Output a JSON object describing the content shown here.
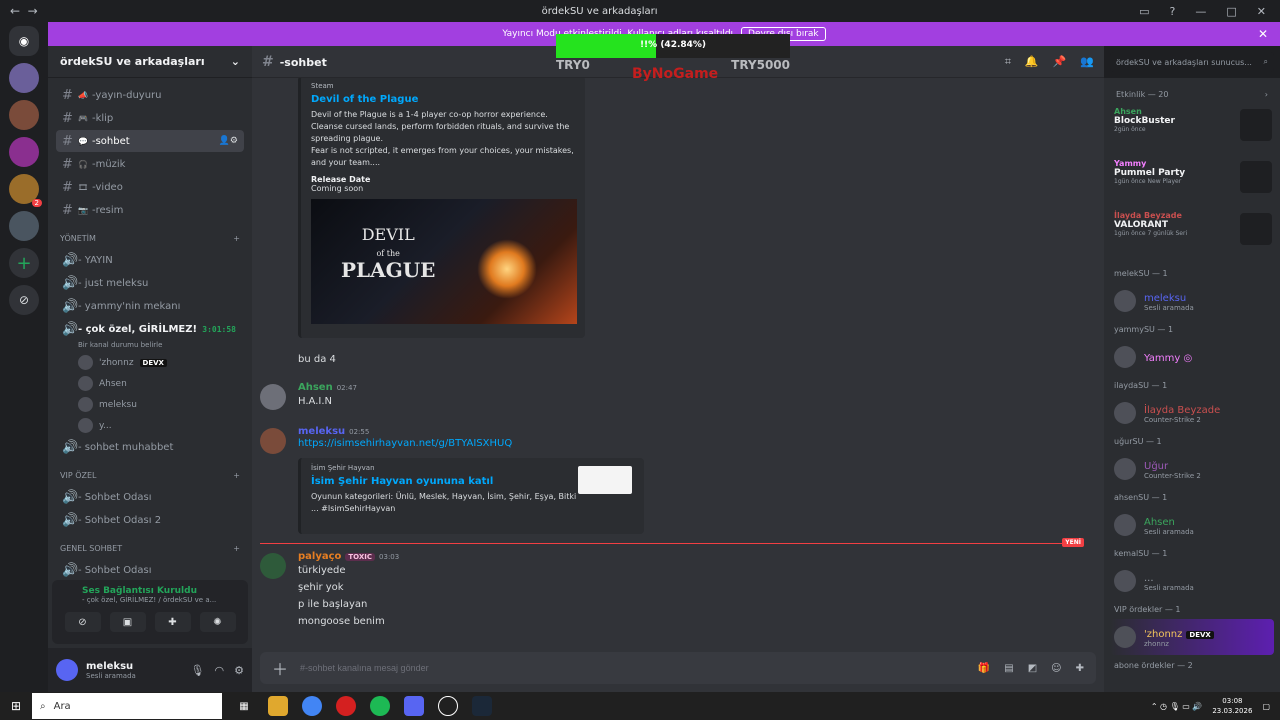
{
  "window": {
    "title": "ördekSU ve arkadaşları"
  },
  "stream_bar": {
    "text": "Yayıncı Modu etkinleştirildi. Kullanıcı adları kısaltıldı",
    "button": "Devre dışı bırak"
  },
  "overlay": {
    "progress_text": "!!% (42.84%)",
    "progress_fraction": 0.4284,
    "left_label": "TRY0",
    "right_label": "TRY5000",
    "brand": "ByNoGame"
  },
  "server": {
    "name": "ördekSU ve arkadaşları"
  },
  "channels_top": [
    {
      "label": "-yayın-duyuru",
      "icon": "megaphone"
    },
    {
      "label": "-klip",
      "icon": "gamepad"
    },
    {
      "label": "-sohbet",
      "icon": "chat",
      "active": true
    },
    {
      "label": "-müzik",
      "icon": "headphones"
    },
    {
      "label": "-video",
      "icon": "film"
    },
    {
      "label": "-resim",
      "icon": "camera"
    }
  ],
  "categories": {
    "yonetim": "YÖNETİM",
    "vip": "VIP Özel",
    "genel": "Genel Sohbet"
  },
  "voice_channels": [
    {
      "label": "- YAYIN"
    },
    {
      "label": "- just meleksu"
    },
    {
      "label": "- yammy'nin mekanı"
    }
  ],
  "private_channel": {
    "label": "- çok özel, GİRİLMEZ!",
    "time": "3:01:58",
    "status": "Bir kanal durumu belirle"
  },
  "voice_users": [
    {
      "name": "'zhonnz",
      "tag": "DEVX"
    },
    {
      "name": "Ahsen"
    },
    {
      "name": "meleksu"
    },
    {
      "name": "y..."
    }
  ],
  "more_voice": [
    {
      "label": "- sohbet muhabbet"
    }
  ],
  "vip_channels": [
    {
      "label": "- Sohbet Odası"
    },
    {
      "label": "- Sohbet Odası 2"
    }
  ],
  "genel_channels": [
    {
      "label": "- Sohbet Odası"
    }
  ],
  "voice_panel": {
    "status": "Ses Bağlantısı Kuruldu",
    "sub": "- çok özel, GİRİLMEZ! / ördekSU ve a..."
  },
  "user_panel": {
    "name": "meleksu",
    "status": "Sesli aramada"
  },
  "chat_header": {
    "title": "-sohbet"
  },
  "embed1": {
    "provider": "Steam",
    "title": "Devil of the Plague",
    "description": "Devil of the Plague is a 1-4 player co-op horror experience.\n        Cleanse cursed lands, perform forbidden rituals, and survive the spreading plague.\n        Fear is not scripted, it emerges from your choices, your mistakes, and your team....",
    "field_name": "Release Date",
    "field_value": "Coming soon",
    "image_word_top": "DEVIL",
    "image_word_small": "of the",
    "image_word_bottom": "PLAGUE"
  },
  "after_embed": "bu da 4",
  "msg_ahsen": {
    "name": "Ahsen",
    "time": "02:47",
    "text": "H.A.I.N"
  },
  "msg_meleksu": {
    "name": "meleksu",
    "time": "02:55",
    "link": "https://isimsehirhayvan.net/g/BTYAISXHUQ"
  },
  "embed2": {
    "provider": "İsim Şehir Hayvan",
    "title": "İsim Şehir Hayvan oyununa katıl",
    "description": "Oyunun kategorileri: Ünlü, Meslek, Hayvan, İsim, Şehir, Eşya, Bitki ... #IsimSehirHayvan"
  },
  "new_label": "YENİ",
  "msg_palyaco": {
    "name": "palyaço",
    "badge": "TOXIC",
    "time": "03:03",
    "lines": [
      "türkiyede",
      "şehir yok",
      "p ile başlayan",
      "mongoose benim"
    ]
  },
  "composer": {
    "placeholder": "#-sohbet kanalına mesaj gönder"
  },
  "search": {
    "placeholder": "ördekSU ve arkadaşları sunucus..."
  },
  "activity_header": "Etkinlik — 20",
  "activities": [
    {
      "user": "Ahsen",
      "game": "BlockBuster",
      "detail": "2gün önce",
      "color": "#3ba55d"
    },
    {
      "user": "Yammy",
      "game": "Pummel Party",
      "detail": "1gün önce   New Player",
      "color": "#f47fff"
    },
    {
      "user": "İlayda Beyzade",
      "game": "VALORANT",
      "detail": "1gün önce   7 günlük Seri",
      "color": "#c94f4f"
    }
  ],
  "member_groups": [
    {
      "title": "melekSU — 1",
      "members": [
        {
          "name": "meleksu",
          "status": "Sesli aramada",
          "color": "#5865f2"
        }
      ]
    },
    {
      "title": "yammySU — 1",
      "members": [
        {
          "name": "Yammy ◎",
          "status": "",
          "color": "#f47fff"
        }
      ]
    },
    {
      "title": "ilaydaSU — 1",
      "members": [
        {
          "name": "İlayda Beyzade",
          "status": "Counter-Strike 2",
          "color": "#c94f4f"
        }
      ]
    },
    {
      "title": "uğurSU — 1",
      "members": [
        {
          "name": "Uğur",
          "status": "Counter-Strike 2",
          "color": "#9b59b6"
        }
      ]
    },
    {
      "title": "ahsenSU — 1",
      "members": [
        {
          "name": "Ahsen",
          "status": "Sesli aramada",
          "color": "#3ba55d"
        }
      ]
    },
    {
      "title": "kemalSU — 1",
      "members": [
        {
          "name": "...",
          "status": "Sesli aramada",
          "color": "#949ba4"
        }
      ]
    },
    {
      "title": "VIP ördekler — 1",
      "members": [
        {
          "name": "'zhonnz",
          "status": "zhonnz",
          "color": "#f2c35c",
          "tag": "DEVX",
          "highlight": true
        }
      ]
    }
  ],
  "last_group": "abone ördekler — 2",
  "taskbar": {
    "search": "Ara",
    "time": "03:08",
    "date": "23.03.2026"
  }
}
